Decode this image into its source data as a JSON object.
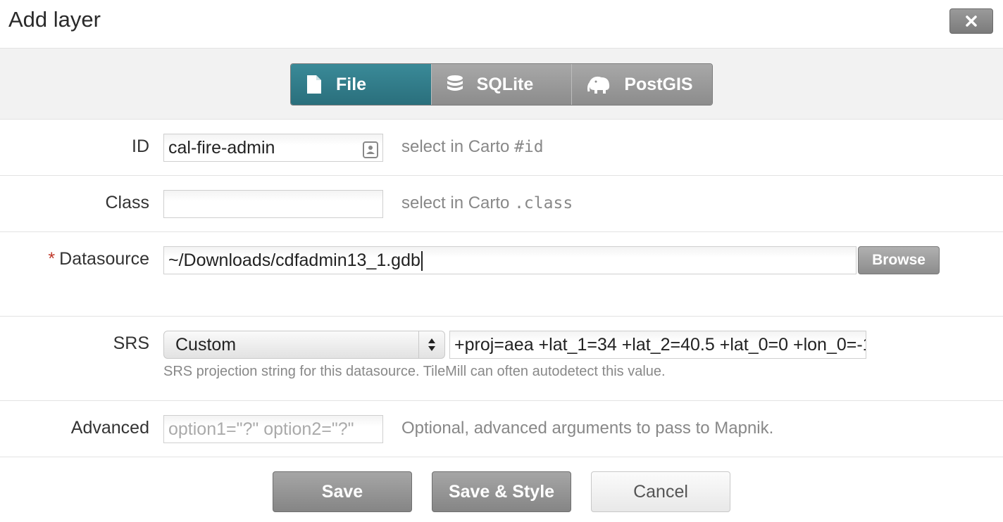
{
  "dialog": {
    "title": "Add layer"
  },
  "tabs": [
    {
      "label": "File",
      "icon": "file-icon",
      "active": true
    },
    {
      "label": "SQLite",
      "icon": "database-icon",
      "active": false
    },
    {
      "label": "PostGIS",
      "icon": "elephant-icon",
      "active": false
    }
  ],
  "form": {
    "id": {
      "label": "ID",
      "value": "cal-fire-admin",
      "hint_prefix": "select in Carto ",
      "hint_code": "#id"
    },
    "class": {
      "label": "Class",
      "value": "",
      "hint_prefix": "select in Carto ",
      "hint_code": ".class"
    },
    "datasource": {
      "required_mark": "*",
      "label": "Datasource",
      "value": "~/Downloads/cdfadmin13_1.gdb",
      "browse_label": "Browse"
    },
    "srs": {
      "label": "SRS",
      "selected": "Custom",
      "value": "+proj=aea +lat_1=34 +lat_2=40.5 +lat_0=0 +lon_0=-1",
      "hint": "SRS projection string for this datasource. TileMill can often autodetect this value."
    },
    "advanced": {
      "label": "Advanced",
      "placeholder": "option1=\"?\" option2=\"?\"",
      "hint": "Optional, advanced arguments to pass to Mapnik."
    }
  },
  "buttons": {
    "save": "Save",
    "save_style": "Save & Style",
    "cancel": "Cancel"
  },
  "colors": {
    "active_tab": "#2f7a87",
    "required": "#c0392b"
  }
}
